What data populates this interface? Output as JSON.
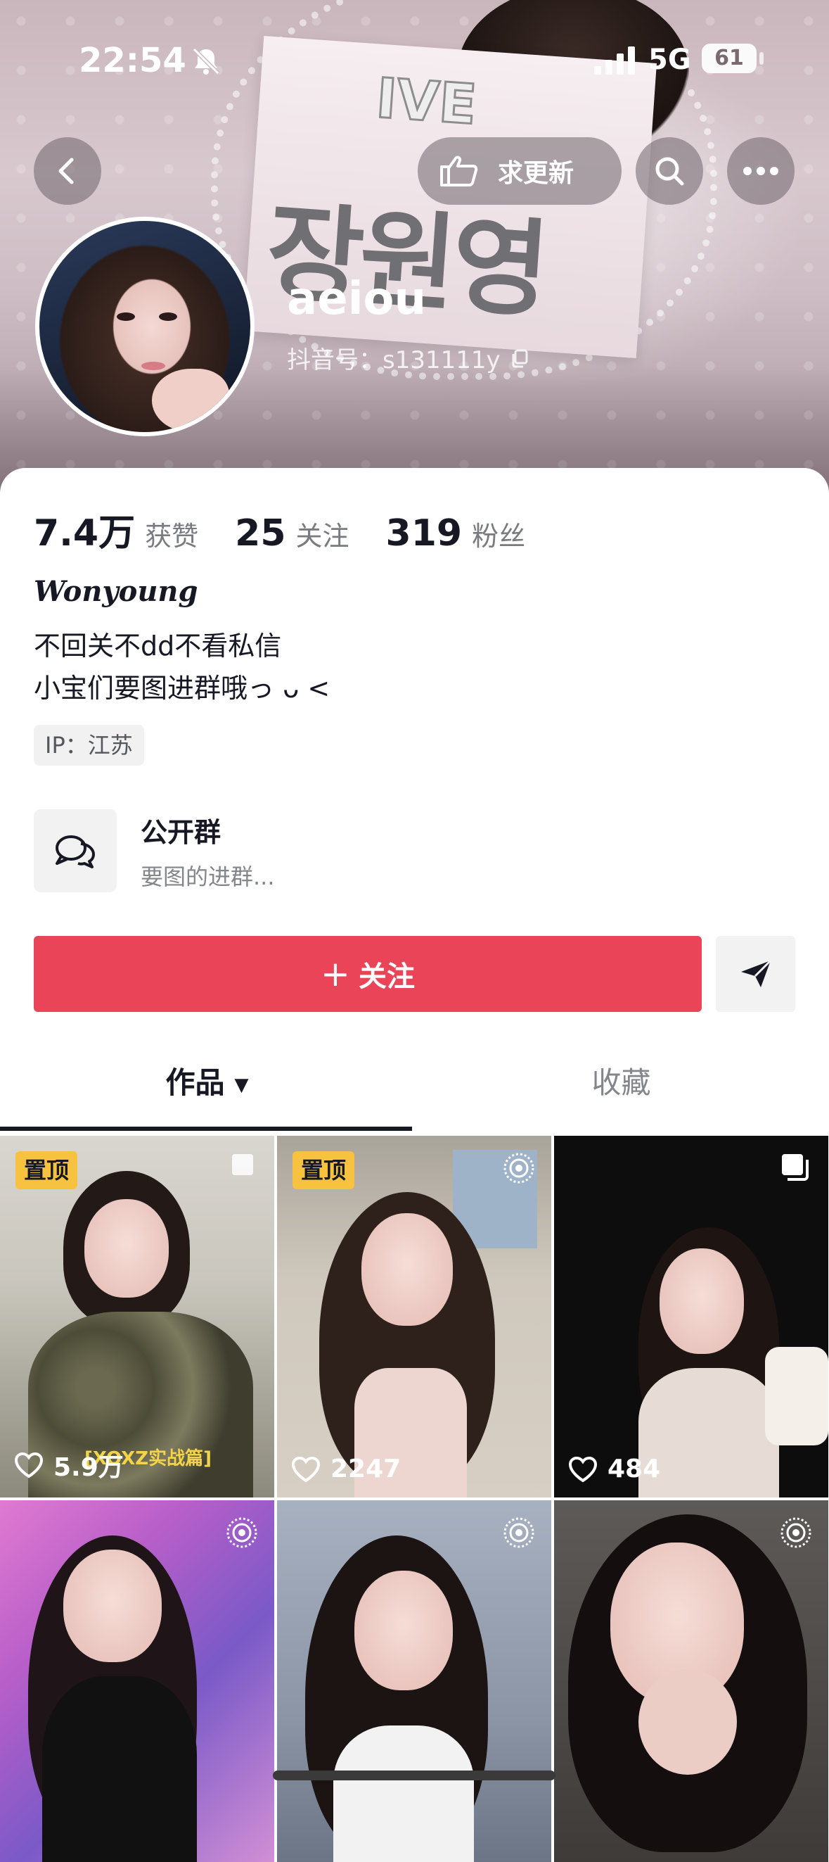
{
  "status_bar": {
    "time": "22:54",
    "network": "5G",
    "battery": "61"
  },
  "header": {
    "update_button_label": "求更新",
    "icons": [
      "back-icon",
      "pointing-hand-icon",
      "search-icon",
      "more-icon",
      "bell-muted-icon",
      "copy-icon"
    ]
  },
  "banner": {
    "card_brand": "IVE",
    "card_name": "장원영"
  },
  "profile": {
    "username": "aeiou",
    "douyin_id": "抖音号：s131111y",
    "stats": [
      {
        "num": "7.4万",
        "label": "获赞"
      },
      {
        "num": "25",
        "label": "关注"
      },
      {
        "num": "319",
        "label": "粉丝"
      }
    ],
    "bio_name": "Wonyoung",
    "bio_lines": [
      "不回关不dd不看私信",
      "小宝们要图进群哦っ ᴗ <"
    ],
    "ip": "IP：江苏"
  },
  "group": {
    "title": "公开群",
    "desc": "要图的进群..."
  },
  "actions": {
    "follow_label": "关注",
    "follow_plus": "+"
  },
  "tabs": {
    "works": "作品",
    "works_caret": "▼",
    "favorites": "收藏"
  },
  "videos": [
    {
      "pinned": "置顶",
      "likes": "5.9万",
      "type": "image",
      "caption": "[XOXZ实战篇]"
    },
    {
      "pinned": "置顶",
      "likes": "2247",
      "type": "live-photo"
    },
    {
      "pinned": "",
      "likes": "484",
      "type": "multi-image"
    },
    {
      "pinned": "",
      "likes": "",
      "type": "live-photo"
    },
    {
      "pinned": "",
      "likes": "",
      "type": "live-photo"
    },
    {
      "pinned": "",
      "likes": "",
      "type": "live-photo"
    }
  ],
  "colors": {
    "accent_red": "#ea4459",
    "pin_yellow": "#f6c23f",
    "text_primary": "#161823",
    "text_secondary": "#7a7b80"
  }
}
